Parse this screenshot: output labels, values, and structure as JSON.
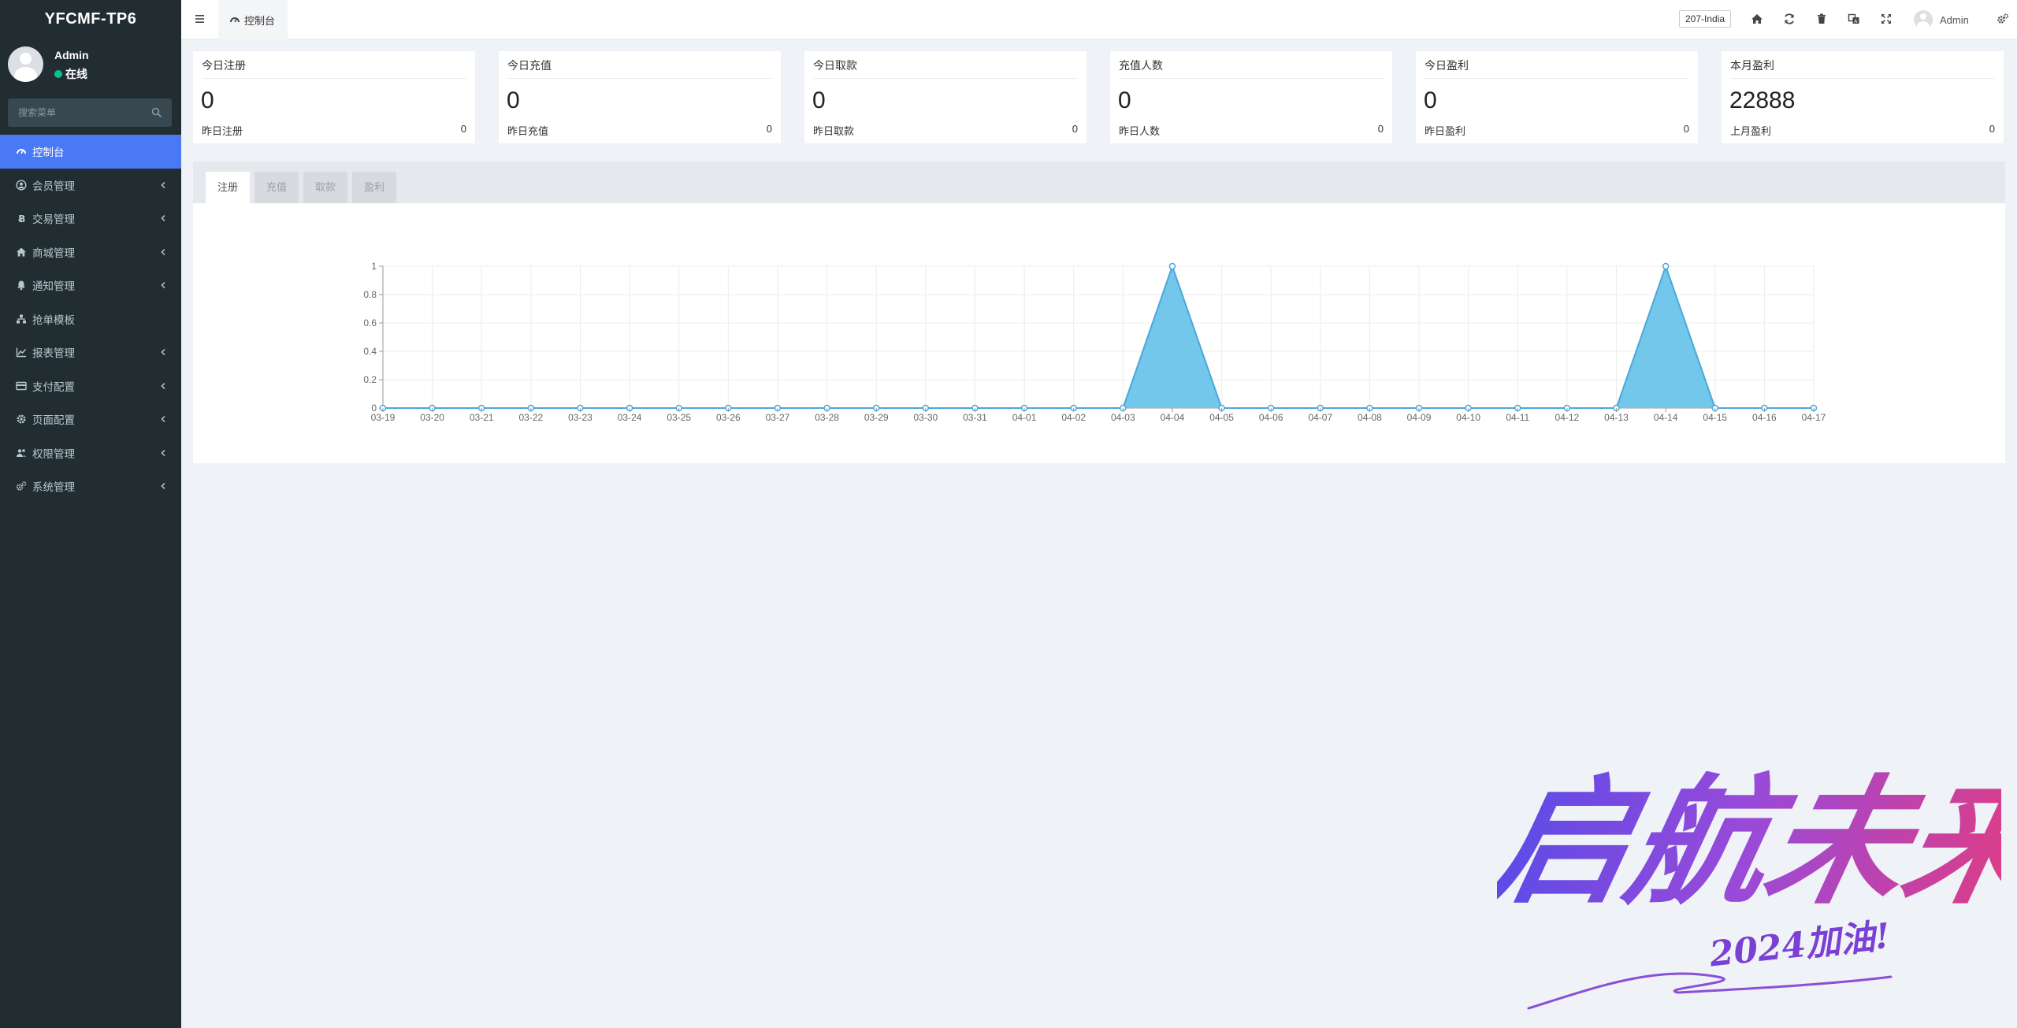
{
  "app": {
    "brand": "YFCMF-TP6"
  },
  "user": {
    "name": "Admin",
    "status": "在线"
  },
  "search": {
    "placeholder": "搜索菜单"
  },
  "menu": [
    {
      "label": "控制台",
      "icon": "dashboard-icon",
      "active": true,
      "has_children": false
    },
    {
      "label": "会员管理",
      "icon": "user-circle-icon",
      "active": false,
      "has_children": true
    },
    {
      "label": "交易管理",
      "icon": "bitcoin-icon",
      "active": false,
      "has_children": true
    },
    {
      "label": "商城管理",
      "icon": "home-icon",
      "active": false,
      "has_children": true
    },
    {
      "label": "通知管理",
      "icon": "bell-icon",
      "active": false,
      "has_children": true
    },
    {
      "label": "抢单模板",
      "icon": "sitemap-icon",
      "active": false,
      "has_children": false
    },
    {
      "label": "报表管理",
      "icon": "line-chart-icon",
      "active": false,
      "has_children": true
    },
    {
      "label": "支付配置",
      "icon": "credit-card-icon",
      "active": false,
      "has_children": true
    },
    {
      "label": "页面配置",
      "icon": "cog-icon",
      "active": false,
      "has_children": true
    },
    {
      "label": "权限管理",
      "icon": "users-icon",
      "active": false,
      "has_children": true
    },
    {
      "label": "系统管理",
      "icon": "cogs-icon",
      "active": false,
      "has_children": true
    }
  ],
  "topbar": {
    "tab_label": "控制台",
    "server": "207-India",
    "admin_name": "Admin"
  },
  "stats": [
    {
      "title": "今日注册",
      "value": "0",
      "sub_label": "昨日注册",
      "sub_value": "0"
    },
    {
      "title": "今日充值",
      "value": "0",
      "sub_label": "昨日充值",
      "sub_value": "0"
    },
    {
      "title": "今日取款",
      "value": "0",
      "sub_label": "昨日取款",
      "sub_value": "0"
    },
    {
      "title": "充值人数",
      "value": "0",
      "sub_label": "昨日人数",
      "sub_value": "0"
    },
    {
      "title": "今日盈利",
      "value": "0",
      "sub_label": "昨日盈利",
      "sub_value": "0"
    },
    {
      "title": "本月盈利",
      "value": "22888",
      "sub_label": "上月盈利",
      "sub_value": "0"
    }
  ],
  "chart_tabs": [
    {
      "label": "注册",
      "active": true
    },
    {
      "label": "充值",
      "active": false
    },
    {
      "label": "取款",
      "active": false
    },
    {
      "label": "盈利",
      "active": false
    }
  ],
  "chart_data": {
    "type": "area",
    "title": "",
    "xlabel": "",
    "ylabel": "",
    "categories": [
      "03-19",
      "03-20",
      "03-21",
      "03-22",
      "03-23",
      "03-24",
      "03-25",
      "03-26",
      "03-27",
      "03-28",
      "03-29",
      "03-30",
      "03-31",
      "04-01",
      "04-02",
      "04-03",
      "04-04",
      "04-05",
      "04-06",
      "04-07",
      "04-08",
      "04-09",
      "04-10",
      "04-11",
      "04-12",
      "04-13",
      "04-14",
      "04-15",
      "04-16",
      "04-17"
    ],
    "values": [
      0,
      0,
      0,
      0,
      0,
      0,
      0,
      0,
      0,
      0,
      0,
      0,
      0,
      0,
      0,
      0,
      1,
      0,
      0,
      0,
      0,
      0,
      0,
      0,
      0,
      0,
      1,
      0,
      0,
      0
    ],
    "ylim": [
      0,
      1
    ],
    "yticks": [
      "0",
      "0.2",
      "0.4",
      "0.6",
      "0.8",
      "1"
    ],
    "grid": true,
    "colors": {
      "fill": "#6cc4ea",
      "line": "#4aa8d8"
    }
  },
  "watermark": {
    "text": "启航未来",
    "subtext": "2024加油!"
  }
}
